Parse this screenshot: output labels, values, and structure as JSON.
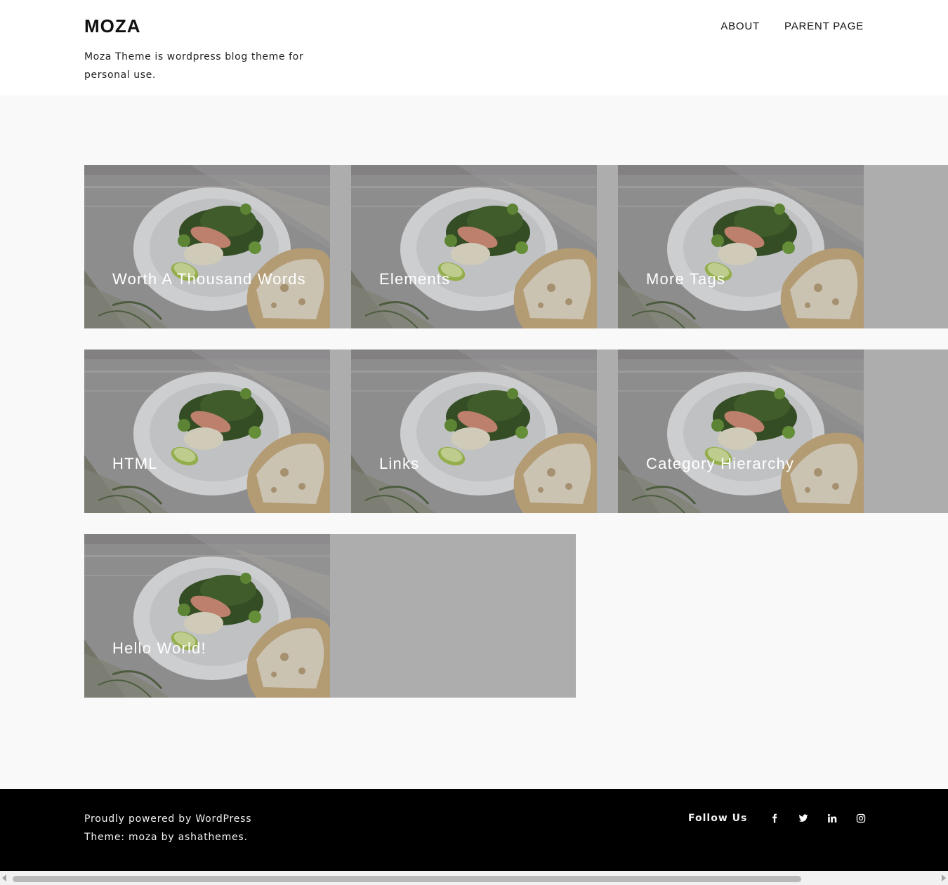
{
  "header": {
    "site_title": "MOZA",
    "tagline": "Moza Theme is wordpress blog theme for personal use.",
    "nav": [
      {
        "label": "ABOUT"
      },
      {
        "label": "PARENT PAGE"
      }
    ]
  },
  "posts": [
    {
      "title": "Worth A Thousand Words"
    },
    {
      "title": "Elements"
    },
    {
      "title": "More Tags"
    },
    {
      "title": "HTML"
    },
    {
      "title": "Links"
    },
    {
      "title": "Category Hierarchy"
    },
    {
      "title": "Hello World!"
    }
  ],
  "footer": {
    "powered_text": "Proudly powered by WordPress",
    "theme_prefix": "Theme: moza by ",
    "theme_author": "ashathemes.",
    "follow_label": "Follow Us",
    "social": [
      {
        "icon": "facebook-icon"
      },
      {
        "icon": "twitter-icon"
      },
      {
        "icon": "linkedin-icon"
      },
      {
        "icon": "instagram-icon"
      }
    ]
  }
}
